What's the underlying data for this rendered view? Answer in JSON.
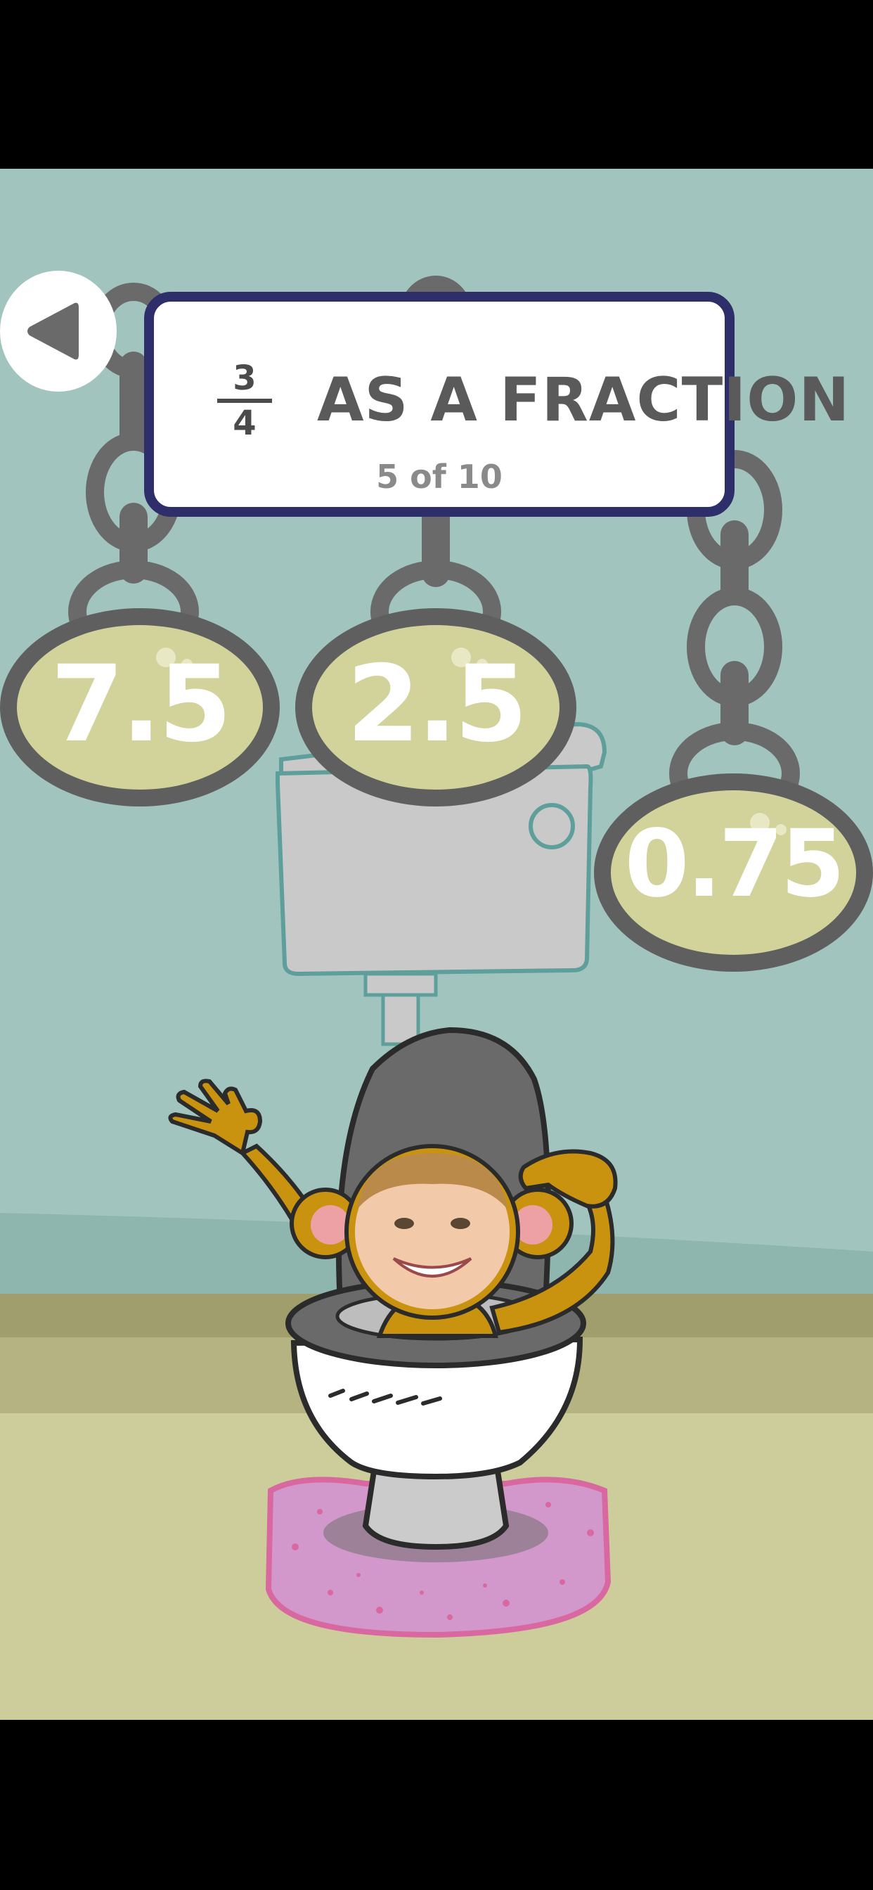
{
  "colors": {
    "wall": "#a2c4bf",
    "floor": "#cdcc9b",
    "card_border": "#2e2e6a",
    "plate_fill": "#d2d29b",
    "chain": "#6a6a6a"
  },
  "question": {
    "numerator": "3",
    "denominator": "4",
    "title": "AS A FRACTION",
    "progress": "5 of 10"
  },
  "answers": [
    {
      "label": "7.5"
    },
    {
      "label": "2.5"
    },
    {
      "label": "0.75"
    }
  ],
  "icons": {
    "back": "back-arrow-icon",
    "toilet": "toilet-illustration",
    "monkey": "monkey-character",
    "face": "player-face-photo",
    "rug": "pink-rug"
  }
}
